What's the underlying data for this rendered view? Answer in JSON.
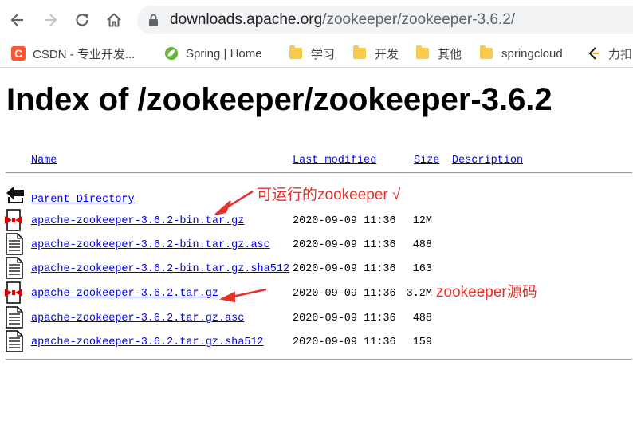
{
  "browser": {
    "url_host": "downloads.apache.org",
    "url_path": "/zookeeper/zookeeper-3.6.2/"
  },
  "bookmarks": [
    {
      "label": "CSDN - 专业开发...",
      "icon": "csdn-icon"
    },
    {
      "label": "Spring | Home",
      "icon": "spring-icon"
    },
    {
      "label": "学习",
      "icon": "folder-icon"
    },
    {
      "label": "开发",
      "icon": "folder-icon"
    },
    {
      "label": "其他",
      "icon": "folder-icon"
    },
    {
      "label": "springcloud",
      "icon": "folder-icon"
    },
    {
      "label": "力扣",
      "icon": "leetcode-icon"
    }
  ],
  "page": {
    "title": "Index of /zookeeper/zookeeper-3.6.2",
    "columns": {
      "name": "Name",
      "modified": "Last modified",
      "size": "Size",
      "description": "Description"
    },
    "parent": {
      "label": "Parent Directory"
    },
    "files": [
      {
        "name": "apache-zookeeper-3.6.2-bin.tar.gz",
        "modified": "2020-09-09 11:36",
        "size": "12M",
        "icon": "archive-icon"
      },
      {
        "name": "apache-zookeeper-3.6.2-bin.tar.gz.asc",
        "modified": "2020-09-09 11:36",
        "size": "488",
        "icon": "text-file-icon"
      },
      {
        "name": "apache-zookeeper-3.6.2-bin.tar.gz.sha512",
        "modified": "2020-09-09 11:36",
        "size": "163",
        "icon": "text-file-icon"
      },
      {
        "name": "apache-zookeeper-3.6.2.tar.gz",
        "modified": "2020-09-09 11:36",
        "size": "3.2M",
        "icon": "archive-icon"
      },
      {
        "name": "apache-zookeeper-3.6.2.tar.gz.asc",
        "modified": "2020-09-09 11:36",
        "size": "488",
        "icon": "text-file-icon"
      },
      {
        "name": "apache-zookeeper-3.6.2.tar.gz.sha512",
        "modified": "2020-09-09 11:36",
        "size": "159",
        "icon": "text-file-icon"
      }
    ]
  },
  "annotations": {
    "runnable": "可运行的zookeeper  √",
    "source": "zookeeper源码",
    "color": "#e5322d"
  }
}
